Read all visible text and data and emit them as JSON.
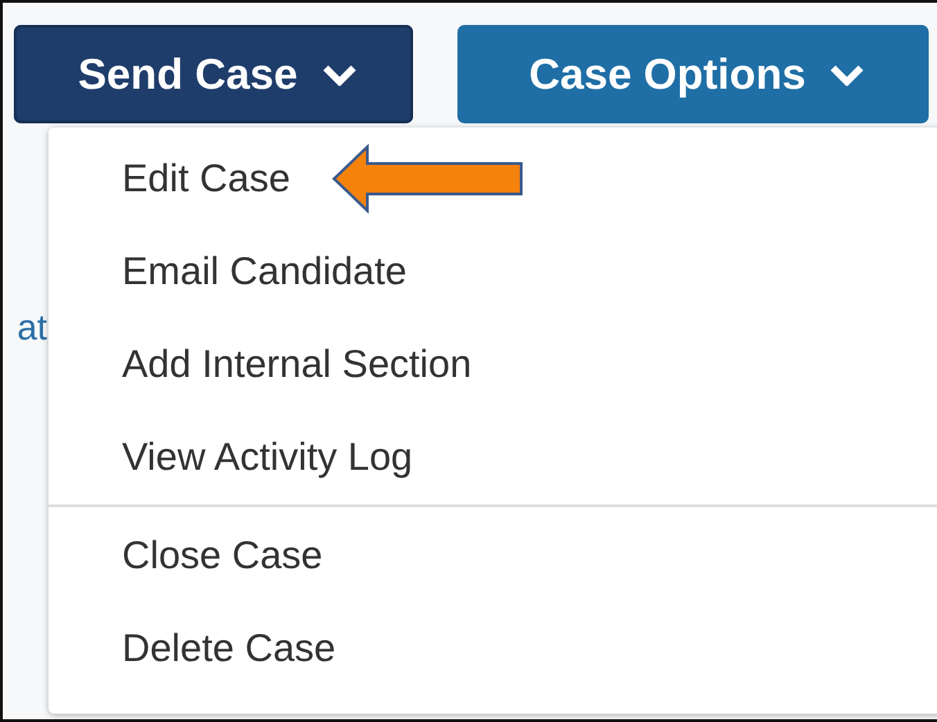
{
  "toolbar": {
    "buttons": [
      {
        "label": "Send Case",
        "kind": "dark",
        "expanded": true
      },
      {
        "label": "Case Options",
        "kind": "light",
        "expanded": false
      }
    ]
  },
  "background_text": "at",
  "menu": {
    "sections": [
      {
        "items": [
          {
            "label": "Edit Case",
            "highlighted": true
          },
          {
            "label": "Email Candidate",
            "highlighted": false
          },
          {
            "label": "Add Internal Section",
            "highlighted": false
          },
          {
            "label": "View Activity Log",
            "highlighted": false
          }
        ]
      },
      {
        "items": [
          {
            "label": "Close Case",
            "highlighted": false
          },
          {
            "label": "Delete Case",
            "highlighted": false
          }
        ]
      }
    ]
  }
}
